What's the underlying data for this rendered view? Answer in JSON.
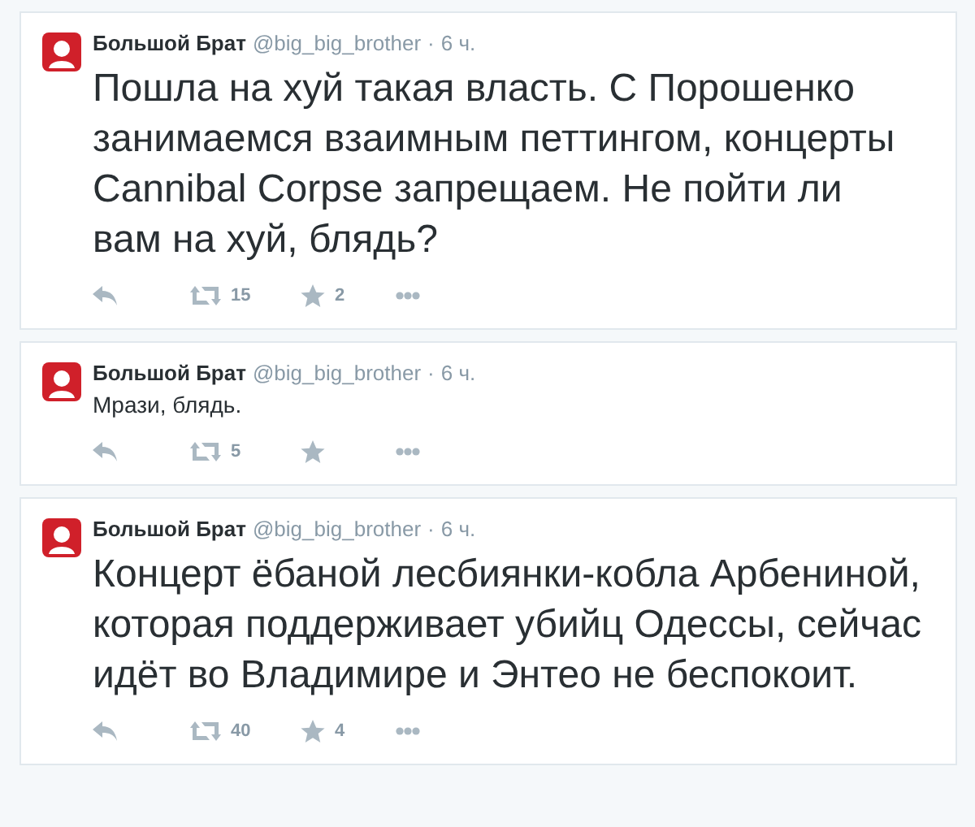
{
  "tweets": [
    {
      "name": "Большой Брат",
      "handle": "@big_big_brother",
      "separator": "·",
      "time": "6 ч.",
      "kind": "large",
      "text": "Пошла на хуй такая власть. С Порошенко занимаемся взаимным петтингом, концерты Cannibal Corpse запрещаем. Не пойти ли вам на хуй, блядь?",
      "retweets": "15",
      "favorites": "2"
    },
    {
      "name": "Большой Брат",
      "handle": "@big_big_brother",
      "separator": "·",
      "time": "6 ч.",
      "kind": "normal",
      "text": "Мрази, блядь.",
      "retweets": "5"
    },
    {
      "name": "Большой Брат",
      "handle": "@big_big_brother",
      "separator": "·",
      "time": "6 ч.",
      "kind": "large",
      "text": "Концерт ёбаной лесбиянки-кобла Арбениной, которая поддерживает убийц Одессы, сейчас идёт во Владимире и Энтео не беспокоит.",
      "retweets": "40",
      "favorites": "4"
    }
  ]
}
